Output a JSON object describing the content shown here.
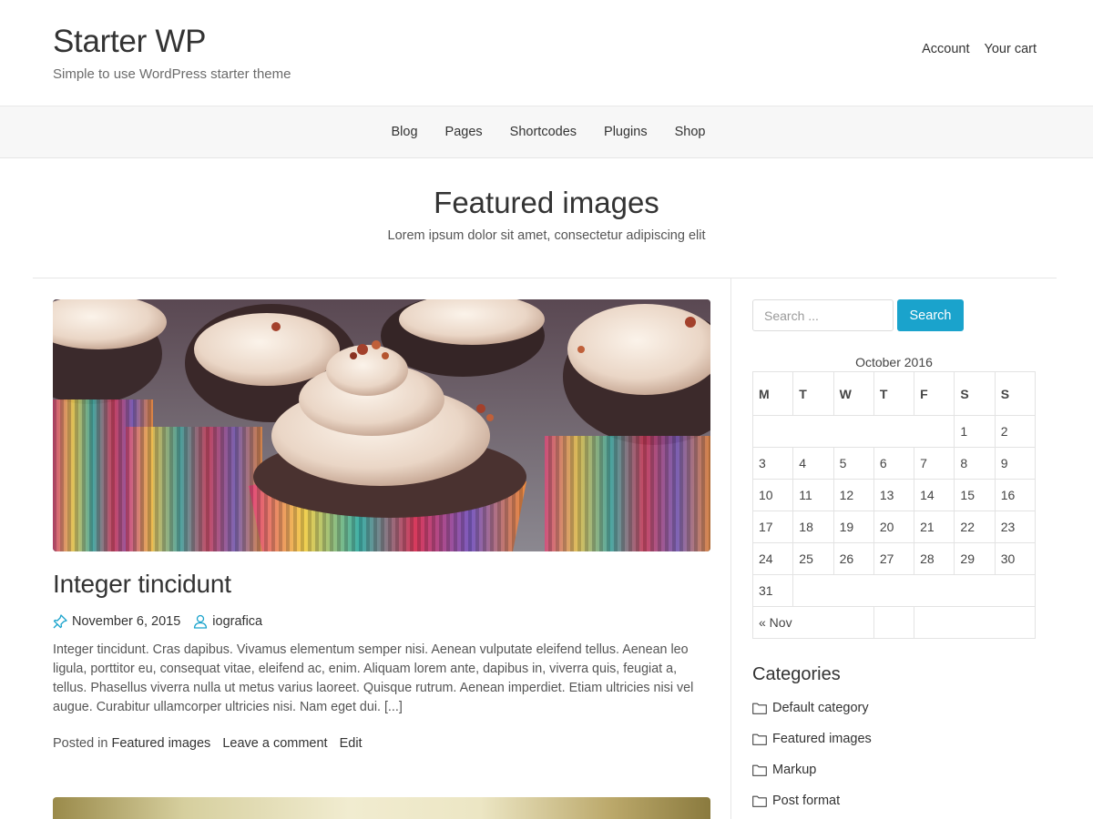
{
  "header": {
    "site_title": "Starter WP",
    "tagline": "Simple to use WordPress starter theme",
    "links": [
      "Account",
      "Your cart"
    ]
  },
  "nav": {
    "items": [
      "Blog",
      "Pages",
      "Shortcodes",
      "Plugins",
      "Shop"
    ]
  },
  "page": {
    "title": "Featured images",
    "subtitle": "Lorem ipsum dolor sit amet, consectetur adipiscing elit"
  },
  "post": {
    "title": "Integer tincidunt",
    "date": "November 6, 2015",
    "author": "iografica",
    "summary": "Integer tincidunt. Cras dapibus. Vivamus elementum semper nisi. Aenean vulputate eleifend tellus. Aenean leo ligula, porttitor eu, consequat vitae, eleifend ac, enim. Aliquam lorem ante, dapibus in, viverra quis, feugiat a, tellus. Phasellus viverra nulla ut metus varius laoreet. Quisque rutrum. Aenean imperdiet. Etiam ultricies nisi vel augue. Curabitur ullamcorper ultricies nisi. Nam eget dui. [...]",
    "posted_in_label": "Posted in",
    "category": "Featured images",
    "comment_link": "Leave a comment",
    "edit_link": "Edit"
  },
  "sidebar": {
    "search": {
      "placeholder": "Search ...",
      "button_label": "Search"
    },
    "calendar": {
      "caption": "October 2016",
      "weekdays": [
        "M",
        "T",
        "W",
        "T",
        "F",
        "S",
        "S"
      ],
      "rows": [
        [
          "",
          "",
          "",
          "",
          "",
          "1",
          "2"
        ],
        [
          "3",
          "4",
          "5",
          "6",
          "7",
          "8",
          "9"
        ],
        [
          "10",
          "11",
          "12",
          "13",
          "14",
          "15",
          "16"
        ],
        [
          "17",
          "18",
          "19",
          "20",
          "21",
          "22",
          "23"
        ],
        [
          "24",
          "25",
          "26",
          "27",
          "28",
          "29",
          "30"
        ],
        [
          "31",
          "",
          "",
          "",
          "",
          "",
          ""
        ]
      ],
      "prev_link": "« Nov"
    },
    "categories": {
      "title": "Categories",
      "items": [
        "Default category",
        "Featured images",
        "Markup",
        "Post format"
      ]
    }
  },
  "colors": {
    "accent": "#1aa3cc",
    "text": "#333333",
    "nav_bg": "#f7f7f7"
  }
}
